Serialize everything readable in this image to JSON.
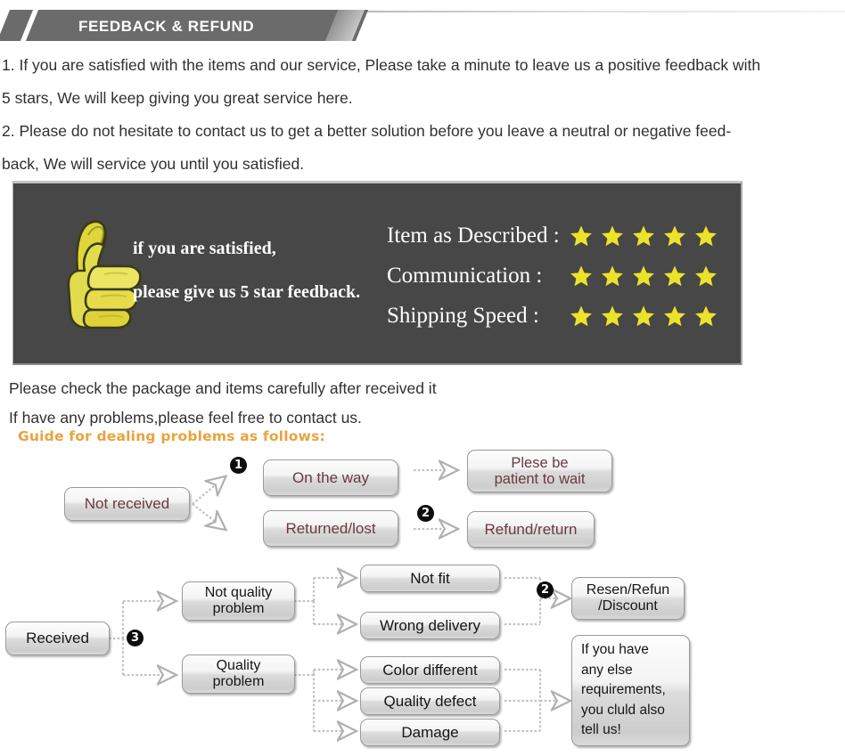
{
  "header": {
    "title": "FEEDBACK & REFUND"
  },
  "intro": {
    "lines": [
      "1. If you are satisfied with the items and our service, Please take a minute to leave us a positive feedback with",
      "5 stars, We will keep giving you great service here.",
      "2. Please do not hesitate to contact us to get a better solution before you leave a neutral or negative feed-",
      "back, We will service you until you satisfied."
    ]
  },
  "feedback_banner": {
    "thumb_line_1": "if you are satisfied,",
    "thumb_line_2": "please give us 5 star feedback.",
    "ratings": [
      {
        "label": "Item as Described :",
        "stars": 5
      },
      {
        "label": "Communication :",
        "stars": 5
      },
      {
        "label": "Shipping Speed :",
        "stars": 5
      }
    ],
    "star_color": "#ece22a",
    "panel_color": "#474747"
  },
  "mid_text": {
    "line_1": "Please check the package and items carefully after received it",
    "line_2": "If have any problems,please feel free to contact us.",
    "guide": "Guide for dealing problems as follows:",
    "guide_color": "#e8a33d"
  },
  "flow_not_received": {
    "source": "Not received",
    "badge_1": "❶",
    "badge_1_text": "1",
    "badge_2_text": "2",
    "on_the_way": "On the way",
    "returned_lost": "Returned/lost",
    "please_wait_line_1": "Plese be",
    "please_wait_line_2": "patient to wait",
    "refund_return": "Refund/return"
  },
  "flow_received": {
    "source": "Received",
    "badge_3_text": "3",
    "badge_2_text": "2",
    "not_quality_line_1": "Not quality",
    "not_quality_line_2": "problem",
    "quality_line_1": "Quality",
    "quality_line_2": "problem",
    "not_fit": "Not fit",
    "wrong_delivery": "Wrong delivery",
    "color_different": "Color different",
    "quality_defect": "Quality defect",
    "damage": "Damage",
    "resend_line_1": "Resen/Refun",
    "resend_line_2": "/Discount",
    "else_line_1": "If you have",
    "else_line_2": "any else",
    "else_line_3": "requirements,",
    "else_line_4": "you cluld also",
    "else_line_5": "tell us!"
  }
}
